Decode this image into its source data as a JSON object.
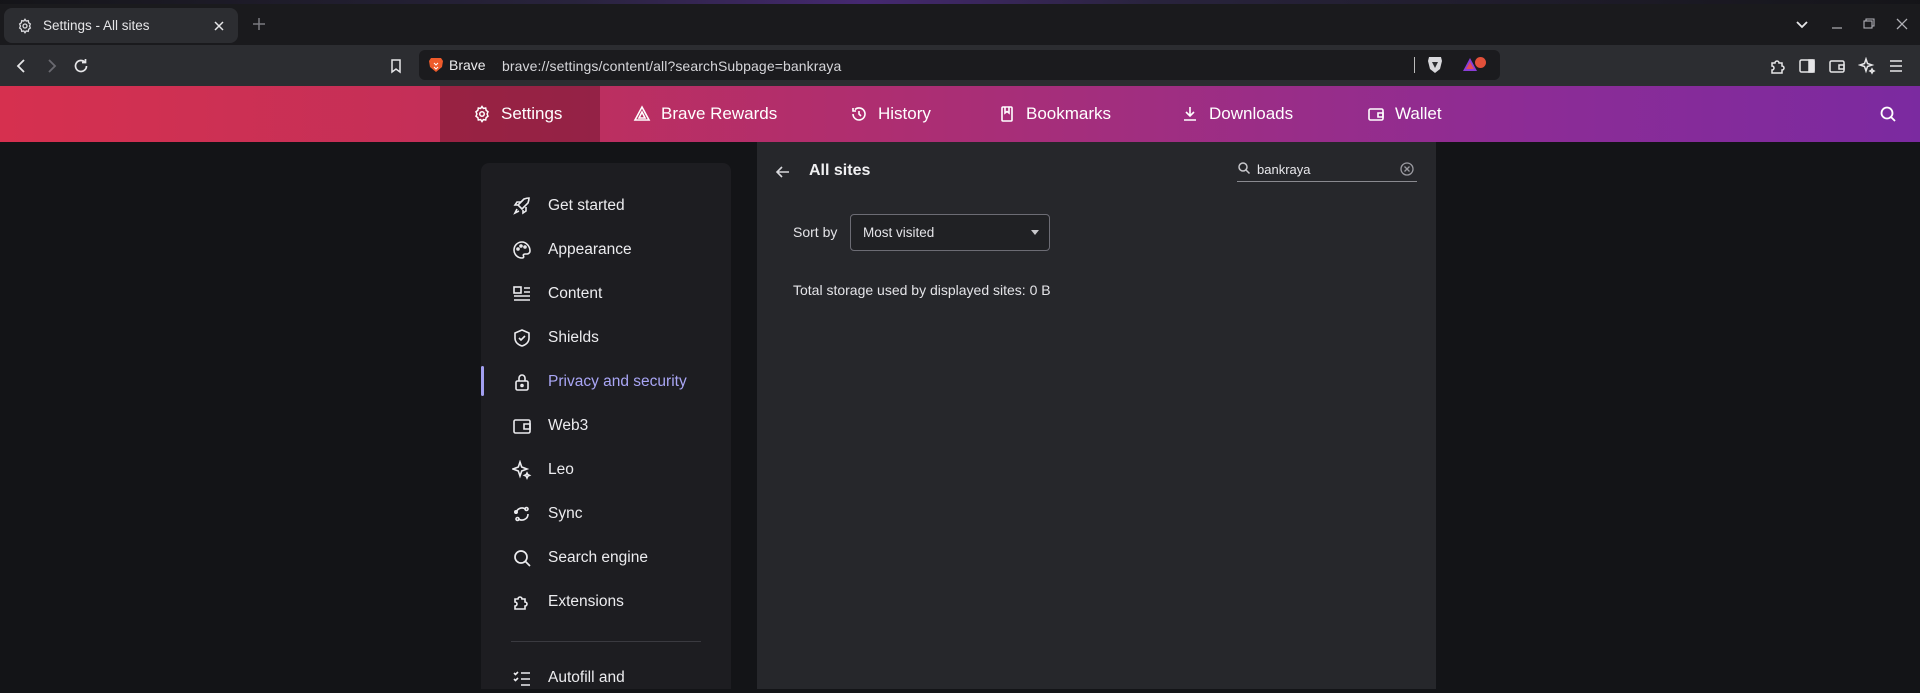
{
  "tab": {
    "title": "Settings - All sites"
  },
  "omnibox": {
    "brand": "Brave",
    "url": "brave://settings/content/all?searchSubpage=bankraya"
  },
  "header": {
    "nav": [
      {
        "label": "Settings",
        "icon": "gear-icon"
      },
      {
        "label": "Brave Rewards",
        "icon": "rewards-triangle-icon"
      },
      {
        "label": "History",
        "icon": "history-icon"
      },
      {
        "label": "Bookmarks",
        "icon": "bookmark-icon"
      },
      {
        "label": "Downloads",
        "icon": "download-icon"
      },
      {
        "label": "Wallet",
        "icon": "wallet-icon"
      }
    ]
  },
  "sidebar": {
    "items": [
      {
        "label": "Get started",
        "icon": "rocket-icon"
      },
      {
        "label": "Appearance",
        "icon": "palette-icon"
      },
      {
        "label": "Content",
        "icon": "content-icon"
      },
      {
        "label": "Shields",
        "icon": "shield-icon"
      },
      {
        "label": "Privacy and security",
        "icon": "lock-icon"
      },
      {
        "label": "Web3",
        "icon": "wallet-icon"
      },
      {
        "label": "Leo",
        "icon": "sparkle-icon"
      },
      {
        "label": "Sync",
        "icon": "sync-icon"
      },
      {
        "label": "Search engine",
        "icon": "search-icon"
      },
      {
        "label": "Extensions",
        "icon": "puzzle-icon"
      },
      {
        "label": "Autofill and",
        "icon": "autofill-icon"
      }
    ],
    "active": "Privacy and security"
  },
  "panel": {
    "title": "All sites",
    "search_value": "bankraya",
    "sort_label": "Sort by",
    "sort_value": "Most visited",
    "storage_text": "Total storage used by displayed sites: 0 B"
  },
  "colors": {
    "header_gradient_start": "#d6304f",
    "header_gradient_end": "#7b2aa0",
    "active_accent": "#a9a6f5"
  }
}
